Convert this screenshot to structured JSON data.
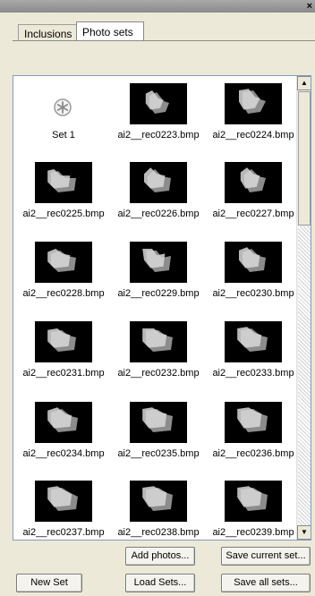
{
  "window": {
    "close_glyph": "×"
  },
  "tabs": [
    {
      "label": "Inclusions",
      "active": false
    },
    {
      "label": "Photo sets",
      "active": true
    }
  ],
  "list": {
    "items": [
      {
        "type": "set",
        "label": "Set 1",
        "icon": "set-icon"
      },
      {
        "type": "photo",
        "label": "ai2__rec0223.bmp",
        "shape": 0
      },
      {
        "type": "photo",
        "label": "ai2__rec0224.bmp",
        "shape": 1
      },
      {
        "type": "photo",
        "label": "ai2__rec0225.bmp",
        "shape": 2
      },
      {
        "type": "photo",
        "label": "ai2__rec0226.bmp",
        "shape": 3
      },
      {
        "type": "photo",
        "label": "ai2__rec0227.bmp",
        "shape": 4
      },
      {
        "type": "photo",
        "label": "ai2__rec0228.bmp",
        "shape": 5
      },
      {
        "type": "photo",
        "label": "ai2__rec0229.bmp",
        "shape": 6
      },
      {
        "type": "photo",
        "label": "ai2__rec0230.bmp",
        "shape": 7
      },
      {
        "type": "photo",
        "label": "ai2__rec0231.bmp",
        "shape": 8
      },
      {
        "type": "photo",
        "label": "ai2__rec0232.bmp",
        "shape": 9
      },
      {
        "type": "photo",
        "label": "ai2__rec0233.bmp",
        "shape": 10
      },
      {
        "type": "photo",
        "label": "ai2__rec0234.bmp",
        "shape": 11
      },
      {
        "type": "photo",
        "label": "ai2__rec0235.bmp",
        "shape": 12
      },
      {
        "type": "photo",
        "label": "ai2__rec0236.bmp",
        "shape": 13
      },
      {
        "type": "photo",
        "label": "ai2__rec0237.bmp",
        "shape": 14
      },
      {
        "type": "photo",
        "label": "ai2__rec0238.bmp",
        "shape": 15
      },
      {
        "type": "photo",
        "label": "ai2__rec0239.bmp",
        "shape": 16
      }
    ]
  },
  "scrollbar": {
    "up_glyph": "▲",
    "down_glyph": "▼"
  },
  "buttons": {
    "add_photos": "Add photos...",
    "save_current_set": "Save current set...",
    "new_set": "New Set",
    "load_sets": "Load Sets...",
    "save_all_sets": "Save all sets..."
  },
  "colors": {
    "thumb_bg": "#000000",
    "object_light": "#d8d8d8",
    "object_dark": "#8c8c8c"
  }
}
